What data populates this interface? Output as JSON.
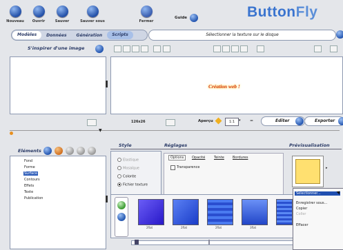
{
  "toolbar": {
    "new": "Nouveau",
    "open": "Ouvrir",
    "save": "Sauver",
    "save_as": "Sauver sous",
    "close": "Fermer",
    "guide": "Guide"
  },
  "brand": {
    "part1": "Button",
    "part2": "Fly"
  },
  "tabs": [
    "Modèles",
    "Données",
    "Génération",
    "Scripts"
  ],
  "path_hint": "Sélectionner la texture sur le disque",
  "left_top": {
    "title": "S'inspirer d'une image"
  },
  "preview_text": "Création web !",
  "status": {
    "size": "126x26",
    "apercu_label": "Aperçu",
    "zoom": "1:1"
  },
  "edit_button": "Editer",
  "export_button": "Exporter",
  "elements_title": "Eléments",
  "tree": [
    "Fond",
    "Forme",
    "Surface",
    "Contours",
    "Effets",
    "Texte",
    "Publication"
  ],
  "style": {
    "title": "Style",
    "options": [
      "Elastique",
      "Mosaïque",
      "Colorée",
      "Fichier texture"
    ],
    "selected": "Fichier texture"
  },
  "reglages": {
    "title": "Réglages",
    "tabs": [
      "Options",
      "Opacité",
      "Teinte",
      "Bordures"
    ],
    "transparence": "Transparence"
  },
  "previsualisation": "Prévisualisation",
  "textures": [
    {
      "label": "2flat",
      "color": "#4a3ae8"
    },
    {
      "label": "2flat",
      "color": "#2f55e6"
    },
    {
      "label": "2flat",
      "color": "#3a68ea"
    },
    {
      "label": "3flat",
      "color": "#3b62df"
    }
  ],
  "context_menu": {
    "items": [
      "Sélectionner...",
      "Enregistrer sous...",
      "Copier",
      "Coller",
      "Effacer"
    ],
    "selected": "Sélectionner...",
    "disabled": [
      "Coller"
    ]
  },
  "colors": {
    "accent": "#3a74cf",
    "preview_swatch": "#ffe070",
    "selection": "#1f4fb0"
  }
}
